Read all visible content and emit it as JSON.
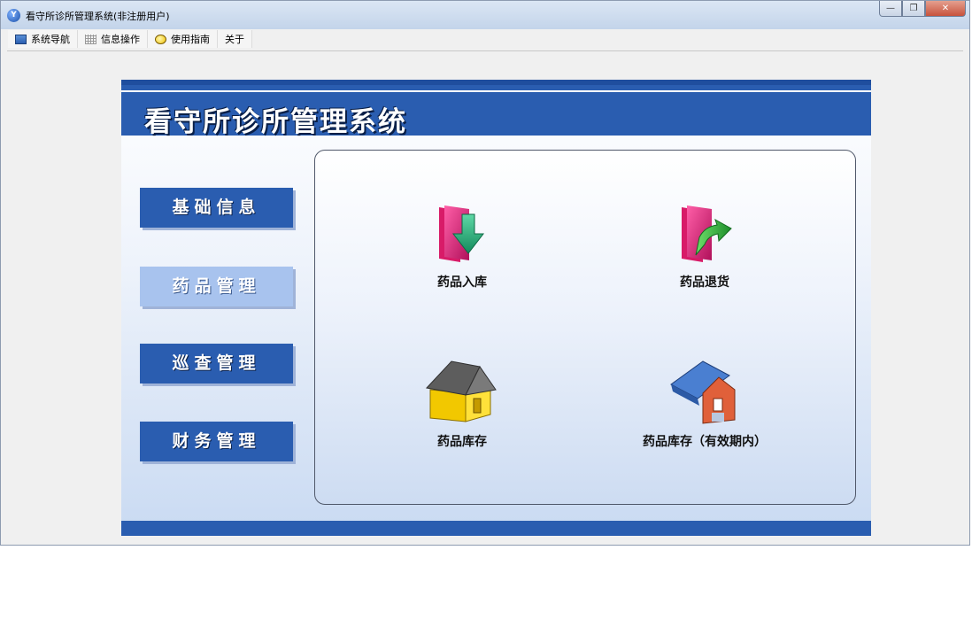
{
  "window": {
    "title": "看守所诊所管理系统(非注册用户)",
    "controls": {
      "minimize": "—",
      "restore": "❐",
      "close": "✕"
    }
  },
  "menu": {
    "items": [
      {
        "label": "系统导航",
        "icon": "monitor-icon"
      },
      {
        "label": "信息操作",
        "icon": "grid-icon"
      },
      {
        "label": "使用指南",
        "icon": "lightbulb-icon"
      },
      {
        "label": "关于",
        "icon": ""
      }
    ]
  },
  "banner": {
    "title": "看守所诊所管理系统"
  },
  "sidebar": {
    "buttons": [
      {
        "label": "基础信息",
        "active": false
      },
      {
        "label": "药品管理",
        "active": true
      },
      {
        "label": "巡查管理",
        "active": false
      },
      {
        "label": "财务管理",
        "active": false
      }
    ]
  },
  "tiles": [
    {
      "label": "药品入库",
      "icon": "folder-down-arrow-icon"
    },
    {
      "label": "药品退货",
      "icon": "folder-return-arrow-icon"
    },
    {
      "label": "药品库存",
      "icon": "yellow-house-icon"
    },
    {
      "label": "药品库存（有效期内）",
      "icon": "house-book-icon"
    }
  ],
  "colors": {
    "accent": "#2a5db0",
    "active_button": "#a8c3ee",
    "titlebar": "#c3d4ea"
  }
}
